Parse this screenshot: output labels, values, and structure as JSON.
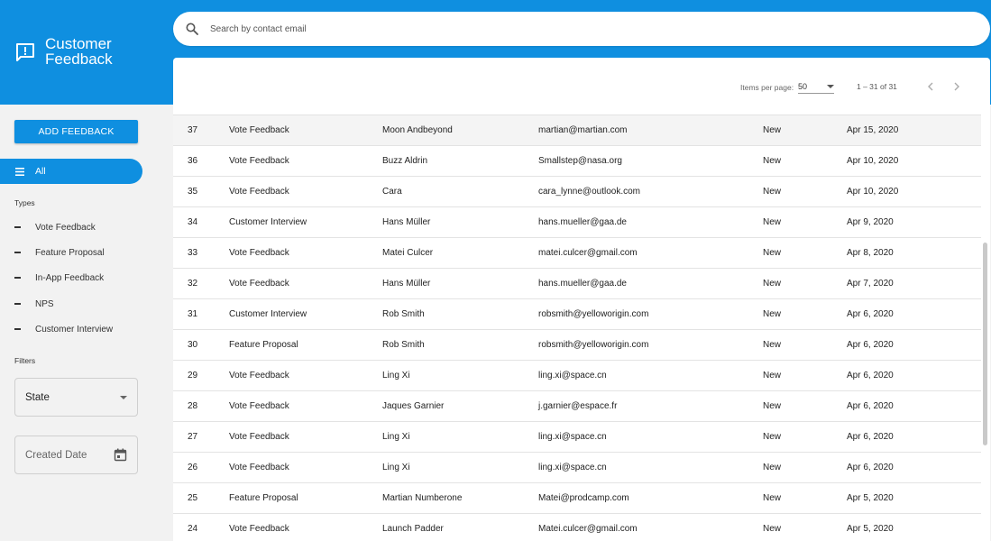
{
  "app": {
    "title_line1": "Customer",
    "title_line2": "Feedback"
  },
  "sidebar": {
    "add_button_label": "ADD FEEDBACK",
    "all_label": "All",
    "types_heading": "Types",
    "types": [
      "Vote Feedback",
      "Feature Proposal",
      "In-App Feedback",
      "NPS",
      "Customer Interview"
    ],
    "filters_heading": "Filters",
    "state_label": "State",
    "created_date_label": "Created Date"
  },
  "search": {
    "placeholder": "Search by contact email"
  },
  "paginator": {
    "items_per_page_label": "Items per page:",
    "items_per_page_value": "50",
    "range_label": "1 – 31 of 31"
  },
  "table": {
    "rows": [
      [
        "37",
        "Vote Feedback",
        "Moon Andbeyond",
        "martian@martian.com",
        "New",
        "Apr 15, 2020"
      ],
      [
        "36",
        "Vote Feedback",
        "Buzz Aldrin",
        "Smallstep@nasa.org",
        "New",
        "Apr 10, 2020"
      ],
      [
        "35",
        "Vote Feedback",
        "Cara",
        "cara_lynne@outlook.com",
        "New",
        "Apr 10, 2020"
      ],
      [
        "34",
        "Customer Interview",
        "Hans Müller",
        "hans.mueller@gaa.de",
        "New",
        "Apr 9, 2020"
      ],
      [
        "33",
        "Vote Feedback",
        "Matei Culcer",
        "matei.culcer@gmail.com",
        "New",
        "Apr 8, 2020"
      ],
      [
        "32",
        "Vote Feedback",
        "Hans Müller",
        "hans.mueller@gaa.de",
        "New",
        "Apr 7, 2020"
      ],
      [
        "31",
        "Customer Interview",
        "Rob Smith",
        "robsmith@yelloworigin.com",
        "New",
        "Apr 6, 2020"
      ],
      [
        "30",
        "Feature Proposal",
        "Rob Smith",
        "robsmith@yelloworigin.com",
        "New",
        "Apr 6, 2020"
      ],
      [
        "29",
        "Vote Feedback",
        "Ling Xi",
        "ling.xi@space.cn",
        "New",
        "Apr 6, 2020"
      ],
      [
        "28",
        "Vote Feedback",
        "Jaques Garnier",
        "j.garnier@espace.fr",
        "New",
        "Apr 6, 2020"
      ],
      [
        "27",
        "Vote Feedback",
        "Ling Xi",
        "ling.xi@space.cn",
        "New",
        "Apr 6, 2020"
      ],
      [
        "26",
        "Vote Feedback",
        "Ling Xi",
        "ling.xi@space.cn",
        "New",
        "Apr 6, 2020"
      ],
      [
        "25",
        "Feature Proposal",
        "Martian Numberone",
        "Matei@prodcamp.com",
        "New",
        "Apr 5, 2020"
      ],
      [
        "24",
        "Vote Feedback",
        "Launch Padder",
        "Matei.culcer@gmail.com",
        "New",
        "Apr 5, 2020"
      ]
    ]
  },
  "colors": {
    "primary": "#0f8fe0",
    "background": "#f2f2f2"
  },
  "icons": {
    "brand": "feedback-icon",
    "search": "search-icon",
    "all": "menu-icon",
    "calendar": "calendar-icon",
    "prev": "chevron-left-icon",
    "next": "chevron-right-icon"
  }
}
